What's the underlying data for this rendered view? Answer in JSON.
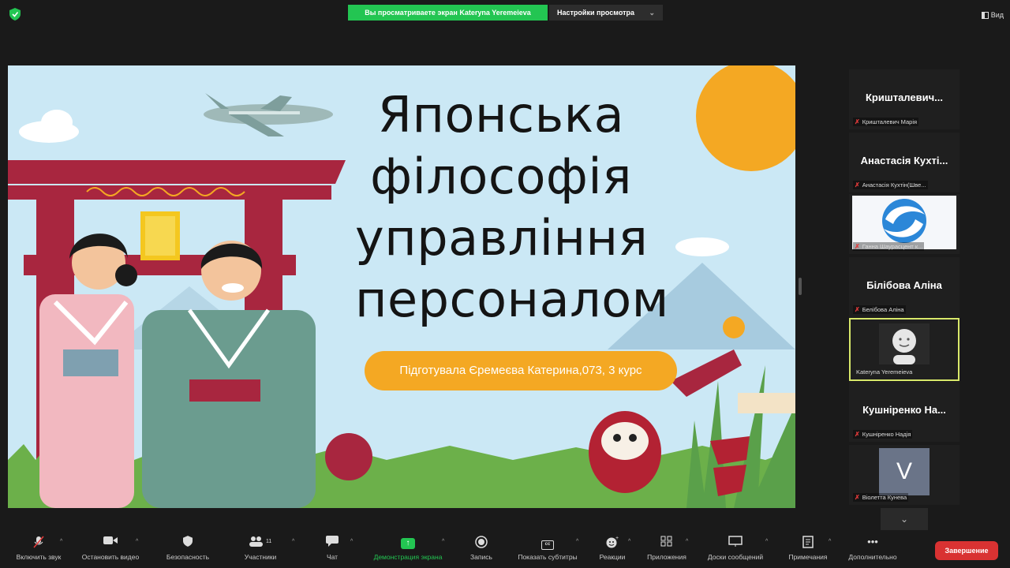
{
  "topbar": {
    "share_banner": "Вы просматриваете экран Kateryna Yeremeieva",
    "view_options": "Настройки просмотра",
    "view_button": "Вид"
  },
  "slide": {
    "title_lines": [
      "Японська",
      "філософія",
      "управління",
      "персоналом"
    ],
    "author": "Підготувала Єремеєва Катерина,073, 3 курс"
  },
  "participants": [
    {
      "name": "Кришталевич...",
      "label": "Кришталевич Марія",
      "muted": true,
      "video": "name"
    },
    {
      "name": "Анастасія Кухті...",
      "label": "Анастасія Кухтін(Шве...",
      "muted": true,
      "video": "name"
    },
    {
      "name": "",
      "label": "Ганна Шаурасцент к...",
      "muted": true,
      "video": "logo"
    },
    {
      "name": "Білібова Аліна",
      "label": "Белібова Аліна",
      "muted": true,
      "video": "name"
    },
    {
      "name": "",
      "label": "Kateryna Yeremeieva",
      "muted": false,
      "video": "avatar",
      "active": true
    },
    {
      "name": "Кушніренко На...",
      "label": "Кушніренко Надія",
      "muted": true,
      "video": "name"
    },
    {
      "name": "V",
      "label": "Віолетта Кунева",
      "muted": true,
      "video": "letter"
    }
  ],
  "toolbar": {
    "buttons": [
      {
        "label": "Включить звук",
        "icon": "mic-muted-icon"
      },
      {
        "label": "Остановить видео",
        "icon": "video-camera-icon"
      },
      {
        "label": "Безопасность",
        "icon": "shield-icon"
      },
      {
        "label": "Участники",
        "icon": "participants-icon",
        "count": "11"
      },
      {
        "label": "Чат",
        "icon": "chat-icon"
      },
      {
        "label": "Демонстрация экрана",
        "icon": "share-screen-icon"
      },
      {
        "label": "Запись",
        "icon": "record-icon"
      },
      {
        "label": "Показать субтитры",
        "icon": "captions-icon"
      },
      {
        "label": "Реакции",
        "icon": "reactions-icon"
      },
      {
        "label": "Приложения",
        "icon": "apps-icon"
      },
      {
        "label": "Доски сообщений",
        "icon": "whiteboard-icon"
      },
      {
        "label": "Примечания",
        "icon": "notes-icon"
      },
      {
        "label": "Дополнительно",
        "icon": "more-icon"
      }
    ],
    "end_label": "Завершение"
  },
  "colors": {
    "share_green": "#23c552",
    "end_red": "#d93232",
    "active_speaker": "#d8e86a",
    "slide_bg": "#cbe8f5",
    "pill_orange": "#f4a823",
    "torii_red": "#a8263f"
  }
}
